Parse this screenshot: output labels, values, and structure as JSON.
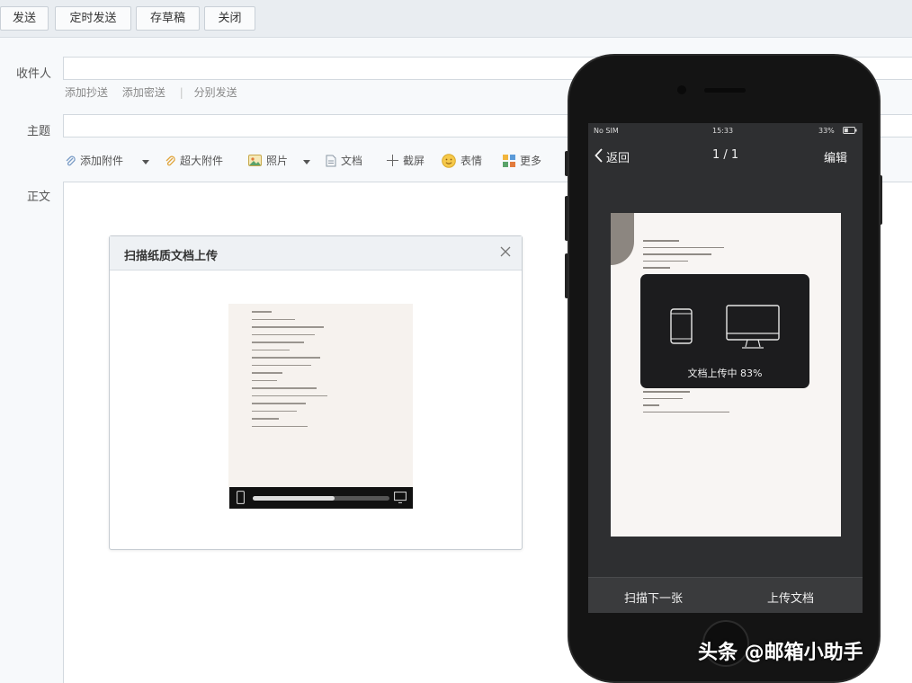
{
  "toolbar": {
    "send_label": "发送",
    "scheduled_send_label": "定时发送",
    "save_draft_label": "存草稿",
    "close_label": "关闭"
  },
  "compose": {
    "recipient_label": "收件人",
    "add_cc": "添加抄送",
    "add_bcc": "添加密送",
    "separate_send": "分别发送",
    "subject_label": "主题",
    "body_label": "正文",
    "attachments": {
      "add_attachment": "添加附件",
      "large_attachment": "超大附件",
      "photo": "照片",
      "document": "文档",
      "screenshot": "截屏",
      "emoji": "表情",
      "more": "更多"
    }
  },
  "dialog": {
    "title": "扫描纸质文档上传",
    "progress": 0.6
  },
  "phone": {
    "status": {
      "carrier": "No SIM",
      "time": "15:33",
      "battery": "33%"
    },
    "nav": {
      "back_label": "返回",
      "page_indicator": "1 / 1",
      "edit_label": "编辑"
    },
    "upload_status": "文档上传中 83%",
    "bottom": {
      "scan_next": "扫描下一张",
      "upload_doc": "上传文档"
    }
  },
  "watermark": "头条 @邮箱小助手",
  "colors": {
    "toolbar_bg": "#e9edf1",
    "phone_body": "#141414",
    "phone_screen": "#2e2f31"
  }
}
